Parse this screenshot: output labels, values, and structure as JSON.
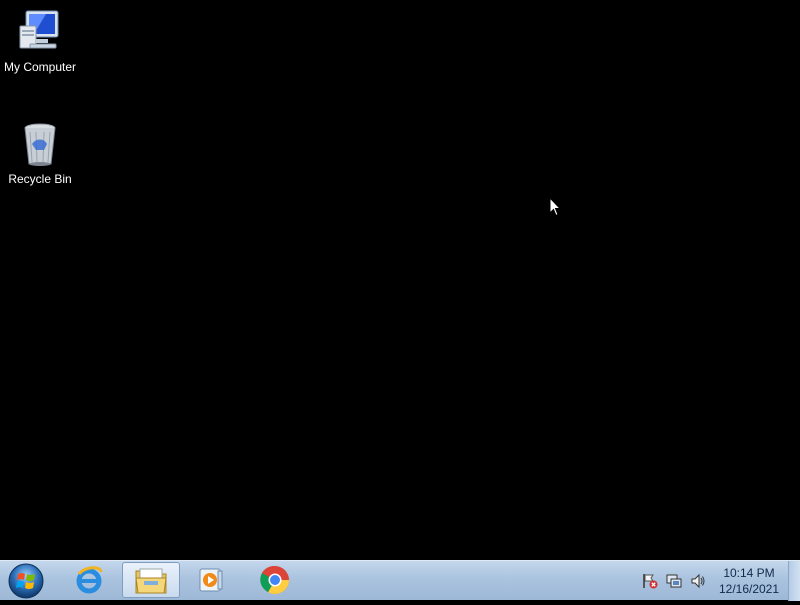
{
  "desktop": {
    "icons": [
      {
        "label": "My Computer",
        "icon": "computer-icon"
      },
      {
        "label": "Recycle Bin",
        "icon": "recycle-bin-icon"
      }
    ]
  },
  "taskbar": {
    "start_icon": "windows-start-orb-icon",
    "pinned": [
      {
        "icon": "internet-explorer-icon"
      },
      {
        "icon": "folder-icon",
        "active": true
      },
      {
        "icon": "media-player-icon"
      },
      {
        "icon": "chrome-icon"
      }
    ],
    "tray": {
      "icons": [
        "action-center-flag-icon",
        "network-icon",
        "volume-icon"
      ],
      "time": "10:14 PM",
      "date": "12/16/2021"
    }
  },
  "colors": {
    "desktop_bg": "#000000",
    "taskbar_bg": "#aac3df",
    "clock_text": "#0f2a4a"
  }
}
